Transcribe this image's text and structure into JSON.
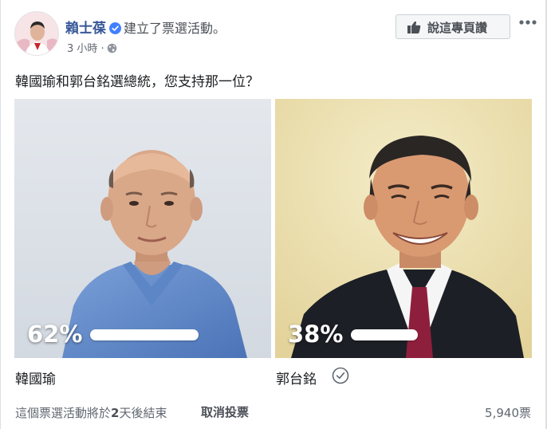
{
  "post": {
    "poster_name": "賴士葆",
    "action_text": "建立了票選活動。",
    "timestamp": "3 小時",
    "separator": "·",
    "like_page_label": "說這專頁讚",
    "question": "韓國瑜和郭台銘選總統，您支持那一位？"
  },
  "poll": {
    "options": [
      {
        "name": "韓國瑜",
        "percent_label": "62%",
        "share": 0.62,
        "voted": false,
        "photo": "portrait-han-kuo-yu"
      },
      {
        "name": "郭台銘",
        "percent_label": "38%",
        "share": 0.38,
        "voted": true,
        "photo": "portrait-terry-gou"
      }
    ],
    "end_note_prefix": "這個票選活動將於",
    "end_note_days": "2",
    "end_note_suffix": "天後結束",
    "cancel_vote_label": "取消投票",
    "vote_count": "5,940票"
  },
  "colors": {
    "link_blue": "#385898",
    "verified_blue": "#4080ff",
    "secondary_text": "#606770",
    "button_bg": "#f5f6f7"
  },
  "icons": [
    "verified-badge-icon",
    "globe-icon",
    "thumbs-up-icon",
    "more-options-icon",
    "vote-check-icon"
  ]
}
